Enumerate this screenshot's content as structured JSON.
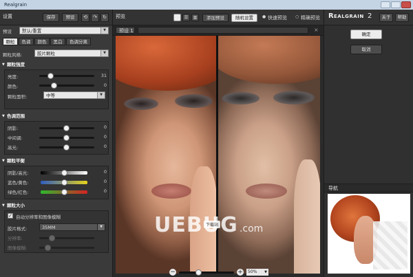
{
  "window": {
    "title": "Realgrain"
  },
  "left": {
    "header_title": "设置",
    "save_label": "保存",
    "preset_label": "预设",
    "preset_row_label": "预设",
    "preset_value": "默认/重置",
    "tabs": [
      "颗粒",
      "色调",
      "颜色",
      "黑白",
      "色调分离"
    ],
    "grain_style_label": "颗粒风格:",
    "grain_style_value": "胶片颗粒",
    "sections": {
      "grain_intensity": {
        "title": "颗粒强度",
        "rows": [
          {
            "label": "亮度:",
            "value": "31",
            "pos": 0.45
          },
          {
            "label": "颜色:",
            "value": "0",
            "pos": 0.55
          }
        ],
        "grain_size_label": "颗粒面积:",
        "grain_size_value": "中等"
      },
      "tonal_range": {
        "title": "色调范围",
        "rows": [
          {
            "label": "阴影:",
            "value": "0",
            "pos": 0.5
          },
          {
            "label": "中间调:",
            "value": "0",
            "pos": 0.5
          },
          {
            "label": "高光:",
            "value": "0",
            "pos": 0.5
          }
        ]
      },
      "grain_balance": {
        "title": "颗粒平衡",
        "rows": [
          {
            "label": "阴影/高光:",
            "value": "0",
            "pos": 0.5
          },
          {
            "label": "蓝色/黄色:",
            "value": "0",
            "pos": 0.5
          },
          {
            "label": "绿色/红色:",
            "value": "0",
            "pos": 0.5
          }
        ]
      },
      "grain_size": {
        "title": "颗粒大小",
        "auto_label": "自动分辨率和图像模糊",
        "film_format_label": "胶片格式:",
        "film_format_value": "35MM",
        "resolution_label": "分辨率:",
        "image_blur_label": "图像模糊:"
      }
    }
  },
  "center": {
    "preview_label": "预览",
    "add_preset": "添加预设",
    "random_settings": "随机设置",
    "fast_preview": "快速预览",
    "precise_preview": "精确预览",
    "preset_tab": "预设 1",
    "zoom_value": "50%",
    "zoom_level": 0.35
  },
  "right": {
    "brand_big": "R",
    "brand_small": "EALGRAIN",
    "brand_version": "2",
    "about": "关于",
    "help": "帮助",
    "ok": "确定",
    "cancel": "取消",
    "navigator": "导航"
  },
  "watermark": {
    "text": "UEBUG",
    "suffix": ".com",
    "badge": "下载站"
  },
  "colors": {
    "panel_bg": "#3a3a3a",
    "accent_blue": "#2f5dbf",
    "accent_yellow": "#e6d21c",
    "accent_green": "#2db82d",
    "accent_red": "#d62222"
  }
}
